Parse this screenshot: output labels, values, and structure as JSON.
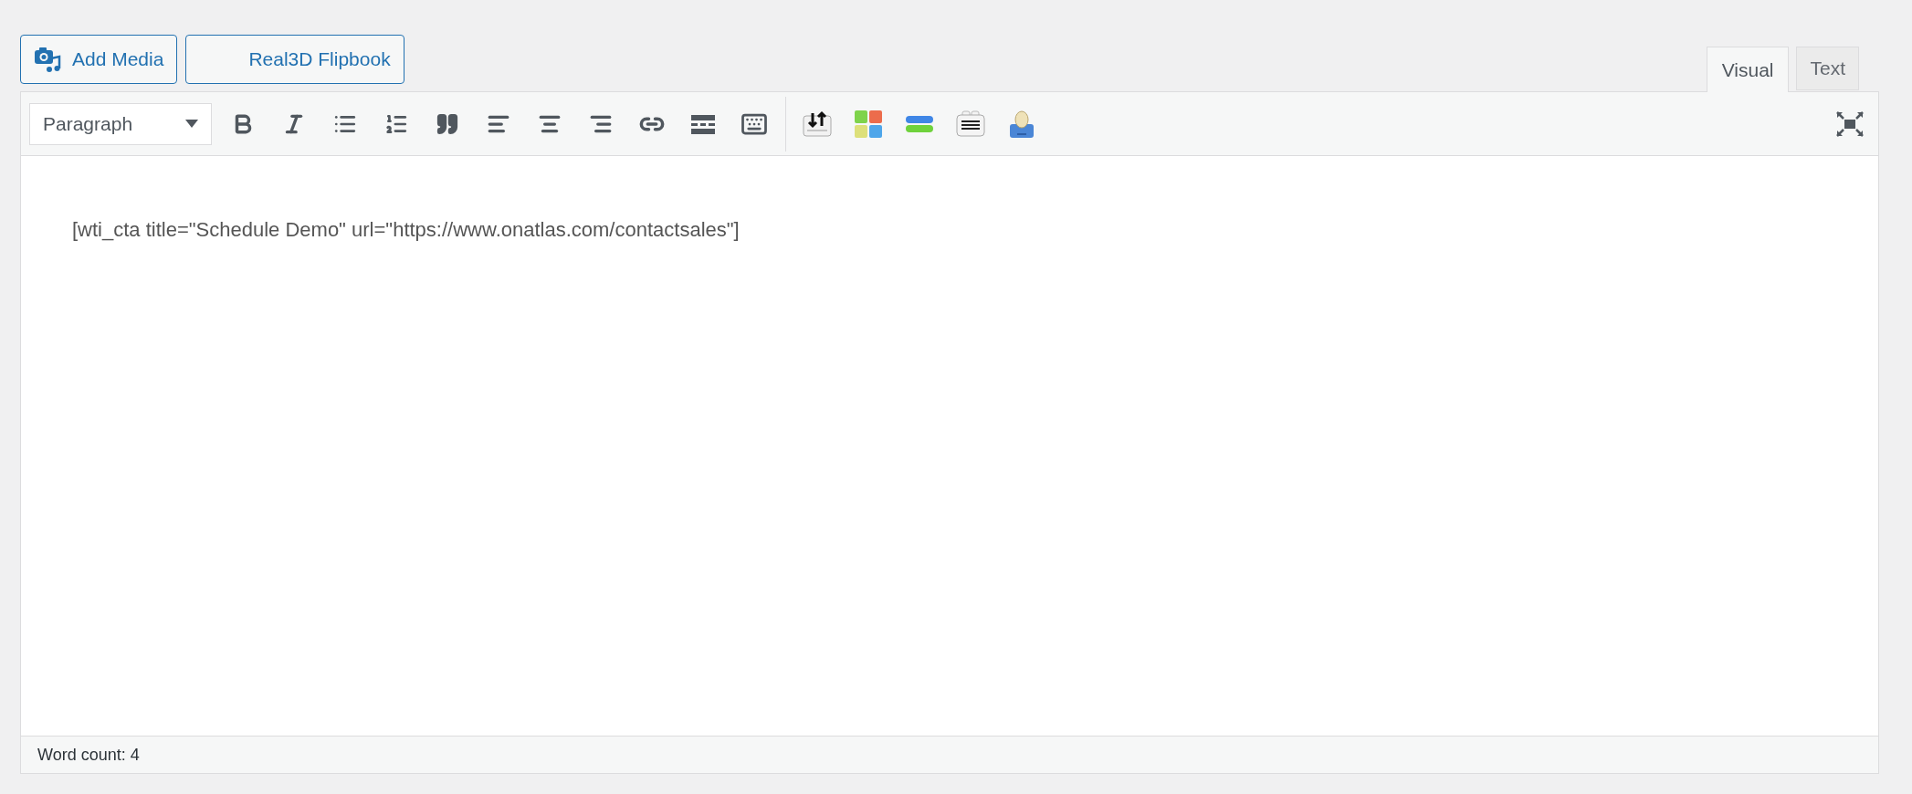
{
  "media_buttons": [
    {
      "label": "Add Media",
      "kind": "media"
    },
    {
      "label": "Real3D Flipbook",
      "kind": "plain"
    }
  ],
  "tabs": [
    {
      "label": "Visual",
      "selected": true
    },
    {
      "label": "Text",
      "selected": false
    }
  ],
  "toolbar": {
    "format_select": "Paragraph"
  },
  "content": "[wti_cta title=\"Schedule Demo\" url=\"https://www.onatlas.com/contactsales\"]",
  "status_bar": {
    "word_count": "Word count: 4"
  }
}
